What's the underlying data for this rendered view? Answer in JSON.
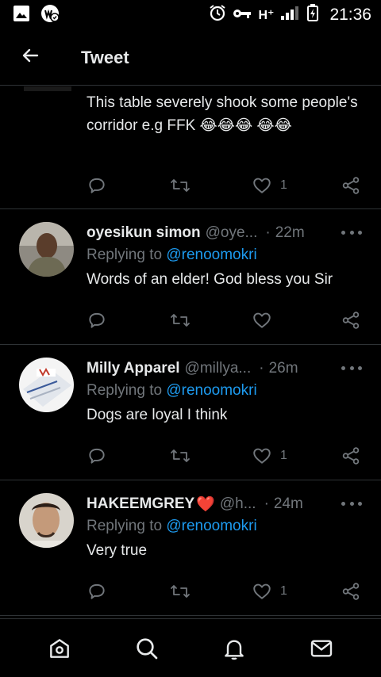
{
  "status_bar": {
    "network": "H⁺",
    "time": "21:36"
  },
  "header": {
    "title": "Tweet"
  },
  "first_tweet": {
    "text": "This table severely shook some people's corridor e.g FFK 😂😂😂 😂😂",
    "likes": "1"
  },
  "replies": [
    {
      "name": "oyesikun simon",
      "handle": "@oye...",
      "time": "22m",
      "replying_label": "Replying to",
      "mention": "@renoomokri",
      "text": "Words of an elder! God bless you Sir",
      "likes": ""
    },
    {
      "name": "Milly Apparel",
      "handle": "@millya...",
      "time": "26m",
      "replying_label": "Replying to",
      "mention": "@renoomokri",
      "text": "Dogs are loyal I think",
      "likes": "1"
    },
    {
      "name": "HAKEEMGREY",
      "name_emoji": "❤️",
      "handle": "@h...",
      "time": "24m",
      "replying_label": "Replying to",
      "mention": "@renoomokri",
      "text": "Very true",
      "likes": "1"
    }
  ],
  "dot_separator": "·",
  "icons": {
    "back": "arrow-left-icon",
    "reply": "comment-icon",
    "retweet": "retweet-icon",
    "like": "heart-icon",
    "share": "share-icon",
    "home": "home-icon",
    "search": "search-icon",
    "notifications": "bell-icon",
    "messages": "envelope-icon"
  },
  "colors": {
    "background": "#000000",
    "text": "#e7e9ea",
    "secondary": "#71767b",
    "accent": "#1d9bf0",
    "divider": "#2f3336"
  }
}
